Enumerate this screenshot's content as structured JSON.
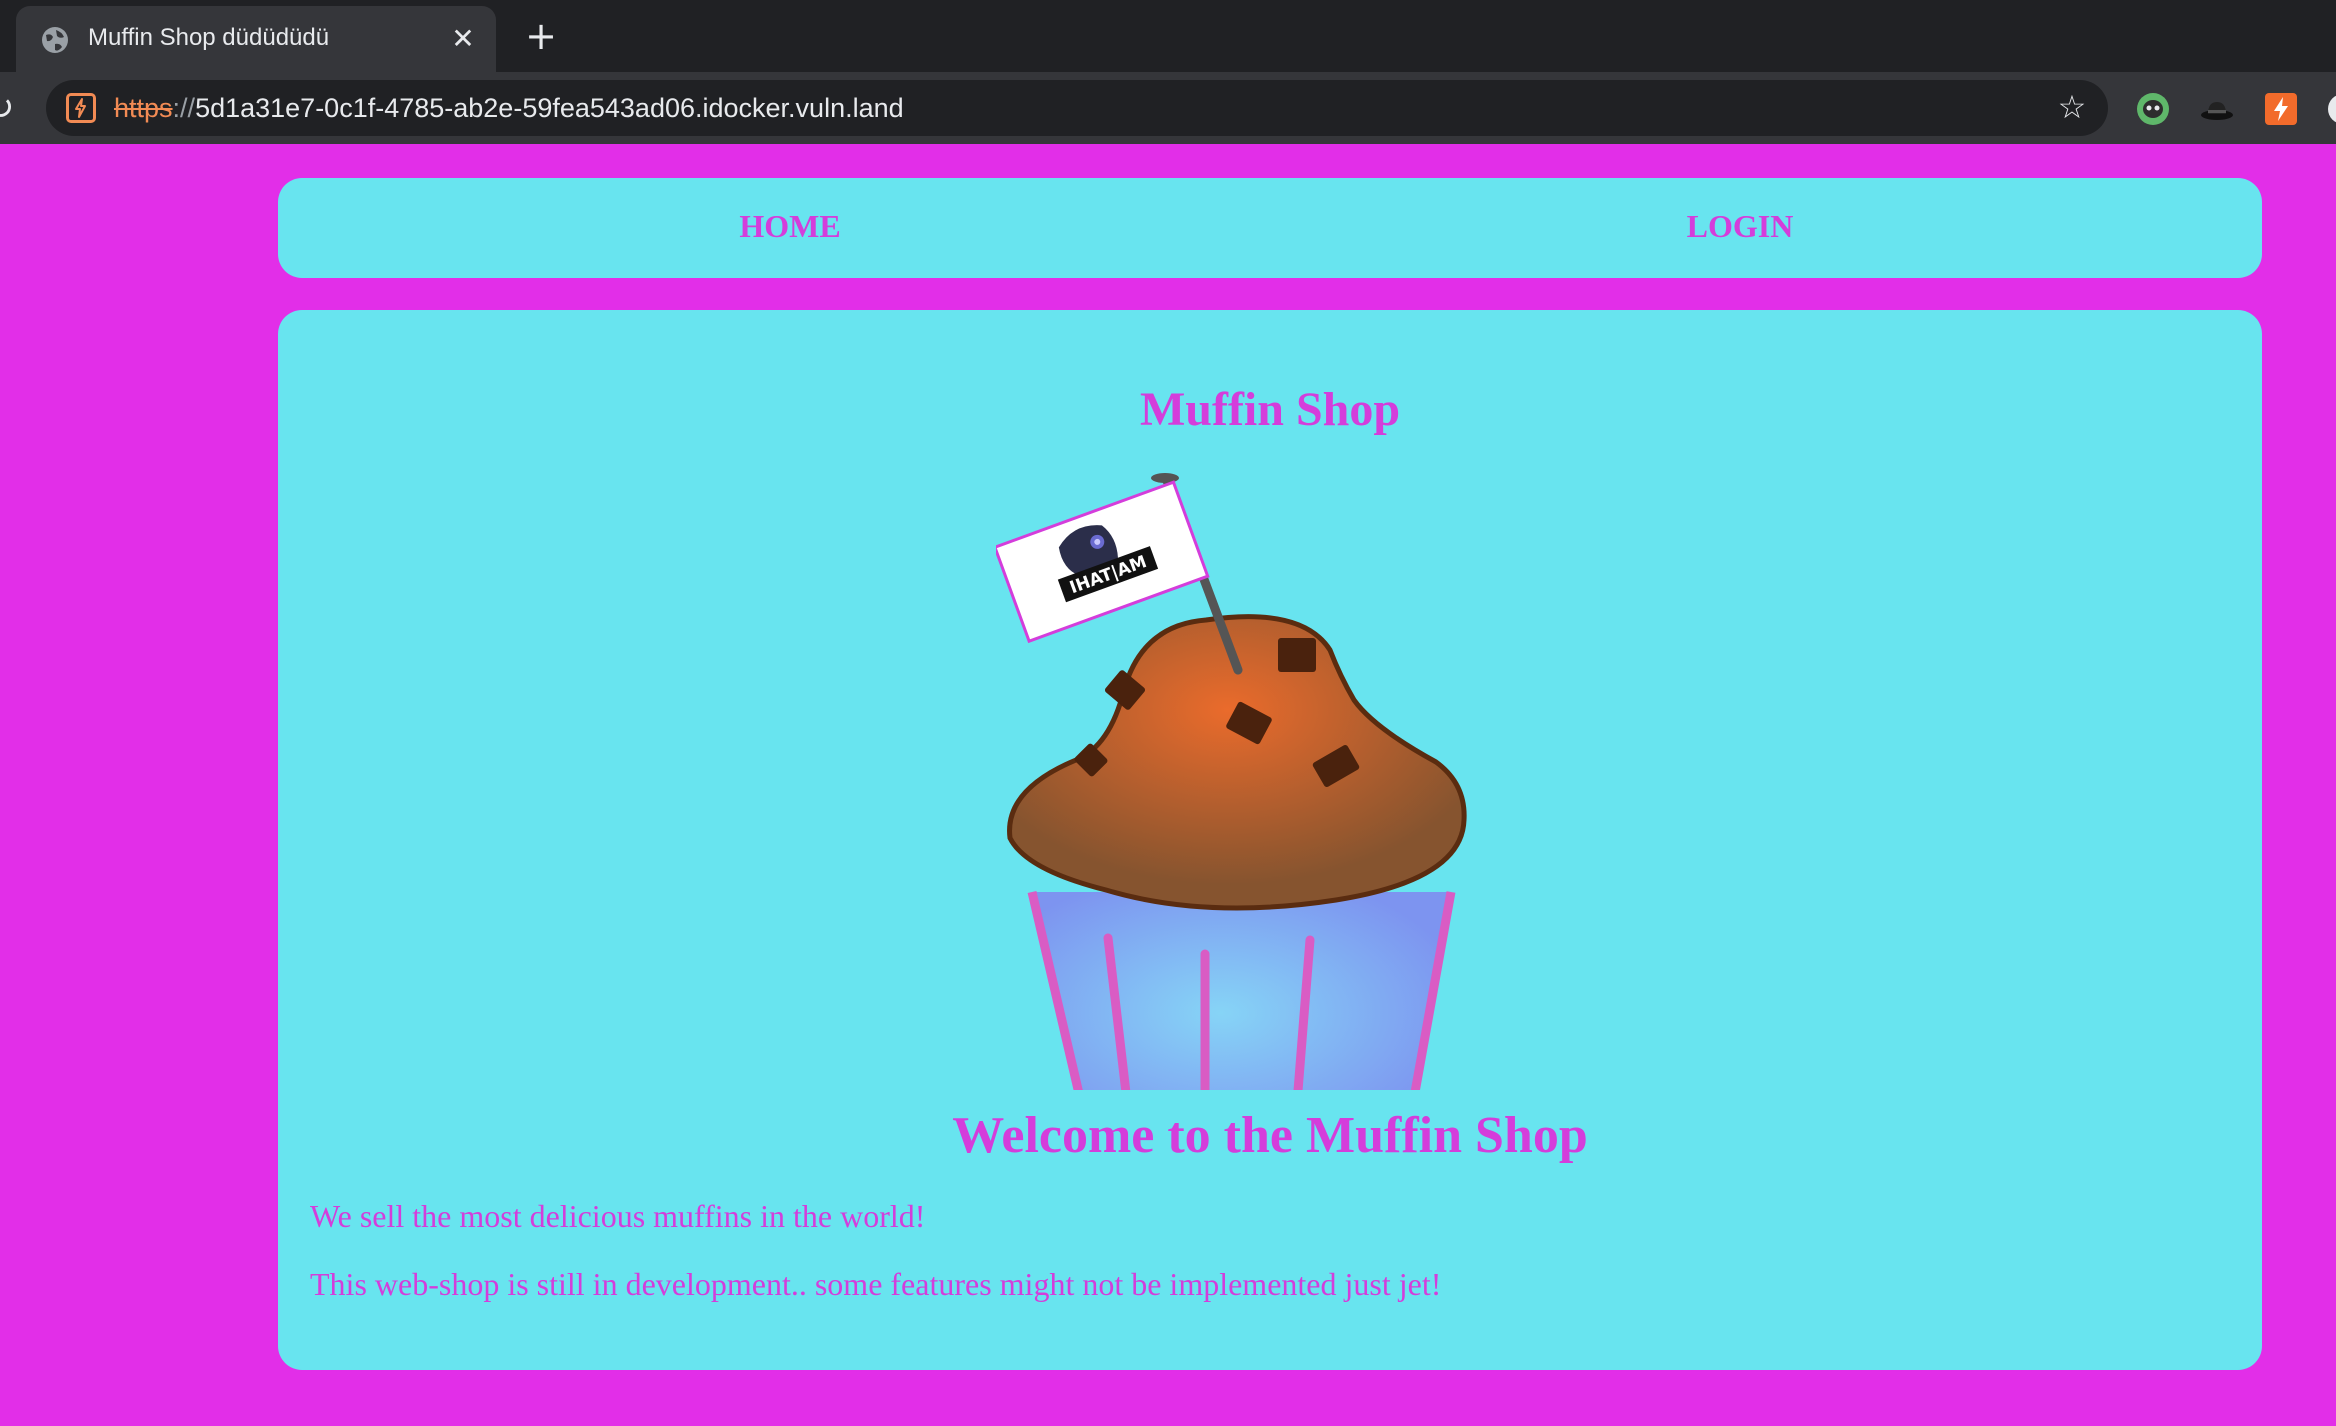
{
  "browser": {
    "tab_title": "Muffin Shop düdüdüdü",
    "tab_close": "✕",
    "new_tab": "+",
    "reload": "↻",
    "url_scheme": "https",
    "url_separator": "://",
    "url_host": "5d1a31e7-0c1f-4785-ab2e-59fea543ad06.idocker.vuln.land",
    "star": "☆",
    "icons": [
      "globe-icon",
      "not-secure-icon",
      "bookmark-star-icon",
      "extension-cat-icon",
      "extension-hat-icon",
      "extension-bolt-icon"
    ]
  },
  "nav": {
    "home_label": "HOME",
    "login_label": "LOGIN"
  },
  "main": {
    "title": "Muffin Shop",
    "flag_text": "IHAT|AM",
    "welcome": "Welcome to the Muffin Shop",
    "paragraph1": "We sell the most delicious muffins in the world!",
    "paragraph2": "This web-shop is still in development.. some features might not be implemented just jet!"
  },
  "colors": {
    "page_background": "#e22ee8",
    "panel_background": "#68e4ef",
    "text_accent": "#d43ddb",
    "chrome_dark": "#202124",
    "chrome_mid": "#35363a"
  }
}
